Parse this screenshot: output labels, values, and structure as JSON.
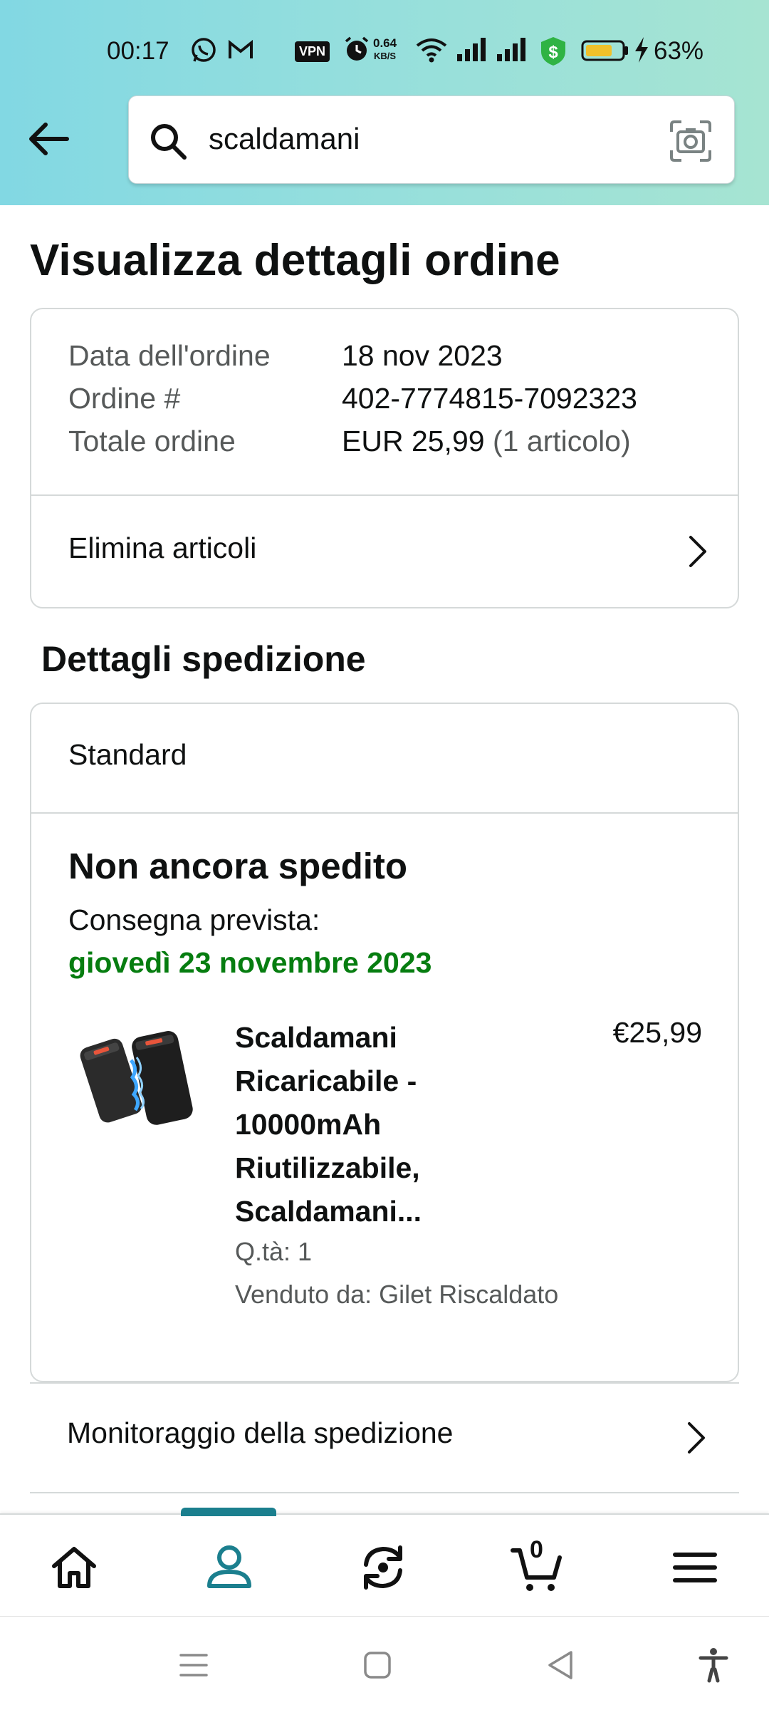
{
  "status_bar": {
    "time": "00:17",
    "vpn_label": "VPN",
    "net_speed_value": "0.64",
    "net_speed_unit": "KB/S",
    "battery_percent": "63%",
    "icons": [
      "whatsapp-icon",
      "gmail-icon",
      "vpn-icon",
      "alarm-icon",
      "wifi-icon",
      "signal-icon",
      "signal-icon",
      "shield-dollar-icon",
      "battery-icon",
      "charging-icon"
    ]
  },
  "search": {
    "query": "scaldamani"
  },
  "page_title": "Visualizza dettagli ordine",
  "order": {
    "date_label": "Data dell'ordine",
    "date_value": "18 nov 2023",
    "number_label": "Ordine #",
    "number_value": "402-7774815-7092323",
    "total_label": "Totale ordine",
    "total_value": "EUR 25,99",
    "total_items": "(1 articolo)",
    "delete_items_label": "Elimina articoli"
  },
  "shipping": {
    "section_title": "Dettagli spedizione",
    "method": "Standard",
    "status": "Non ancora spedito",
    "delivery_label": "Consegna prevista:",
    "delivery_date": "giovedì 23 novembre 2023",
    "product": {
      "title_lines": [
        "Scaldamani",
        "Ricaricabile -",
        "10000mAh",
        "Riutilizzabile,",
        "Scaldamani..."
      ],
      "price": "€25,99",
      "quantity": "Q.tà: 1",
      "seller": "Venduto da: Gilet Riscaldato"
    },
    "tracking_label": "Monitoraggio della spedizione"
  },
  "bottom_nav": {
    "items": [
      "home-icon",
      "account-icon",
      "returns-icon",
      "cart-icon",
      "menu-icon"
    ],
    "active": "account-icon",
    "cart_count": "0"
  },
  "colors": {
    "accent": "#1b7f8e",
    "delivery_green": "#067d10",
    "header_left": "#82d8e3",
    "header_right": "#a6e4d2"
  }
}
